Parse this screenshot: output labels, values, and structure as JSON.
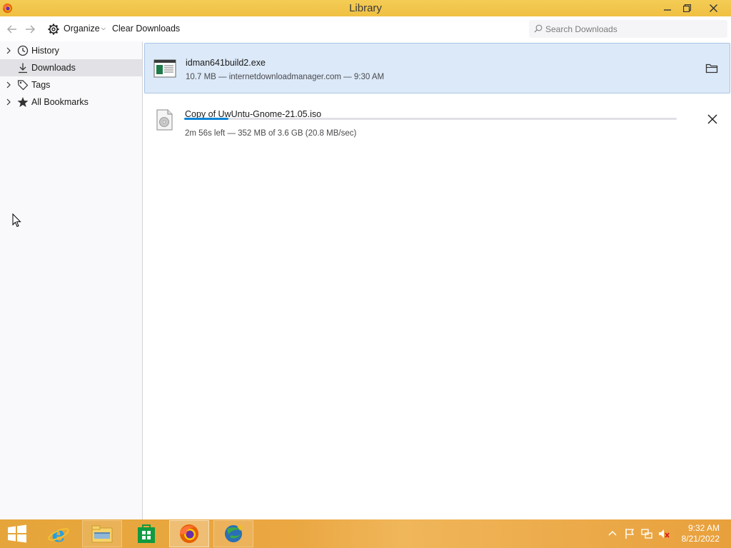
{
  "window": {
    "title": "Library",
    "controls": {
      "minimize": "minimize",
      "restore": "restore",
      "close": "close"
    }
  },
  "toolbar": {
    "back_icon": "arrow-left-icon",
    "forward_icon": "arrow-right-icon",
    "organize_label": "Organize",
    "clear_downloads_label": "Clear Downloads",
    "search_placeholder": "Search Downloads"
  },
  "sidebar": {
    "items": [
      {
        "label": "History",
        "icon": "clock-icon",
        "expandable": true,
        "selected": false
      },
      {
        "label": "Downloads",
        "icon": "download-icon",
        "expandable": false,
        "selected": true
      },
      {
        "label": "Tags",
        "icon": "tag-icon",
        "expandable": true,
        "selected": false
      },
      {
        "label": "All Bookmarks",
        "icon": "star-icon",
        "expandable": true,
        "selected": false
      }
    ]
  },
  "downloads": [
    {
      "name": "idman641build2.exe",
      "status": "10.7 MB — internetdownloadmanager.com — 9:30 AM",
      "icon": "exe-file-icon",
      "action": "open-folder-icon",
      "selected": true
    },
    {
      "name": "Copy of UwUntu-Gnome-21.05.iso",
      "status": "2m 56s left — 352 MB of 3.6 GB (20.8 MB/sec)",
      "icon": "disc-image-file-icon",
      "action": "cancel-icon",
      "progress": 0.09,
      "selected": false
    }
  ],
  "taskbar": {
    "apps": [
      {
        "name": "internet-explorer-icon"
      },
      {
        "name": "file-explorer-icon"
      },
      {
        "name": "store-icon"
      },
      {
        "name": "firefox-icon"
      },
      {
        "name": "internet-download-manager-icon"
      }
    ],
    "tray": [
      "show-hidden-icons",
      "flag-icon",
      "network-icon",
      "volume-muted-icon"
    ],
    "clock_time": "9:32 AM",
    "clock_date": "8/21/2022"
  },
  "colors": {
    "titlebar": "#f2c94c",
    "selection": "#dce9f8",
    "progress": "#0a84d6",
    "taskbar": "#e8a53c"
  }
}
